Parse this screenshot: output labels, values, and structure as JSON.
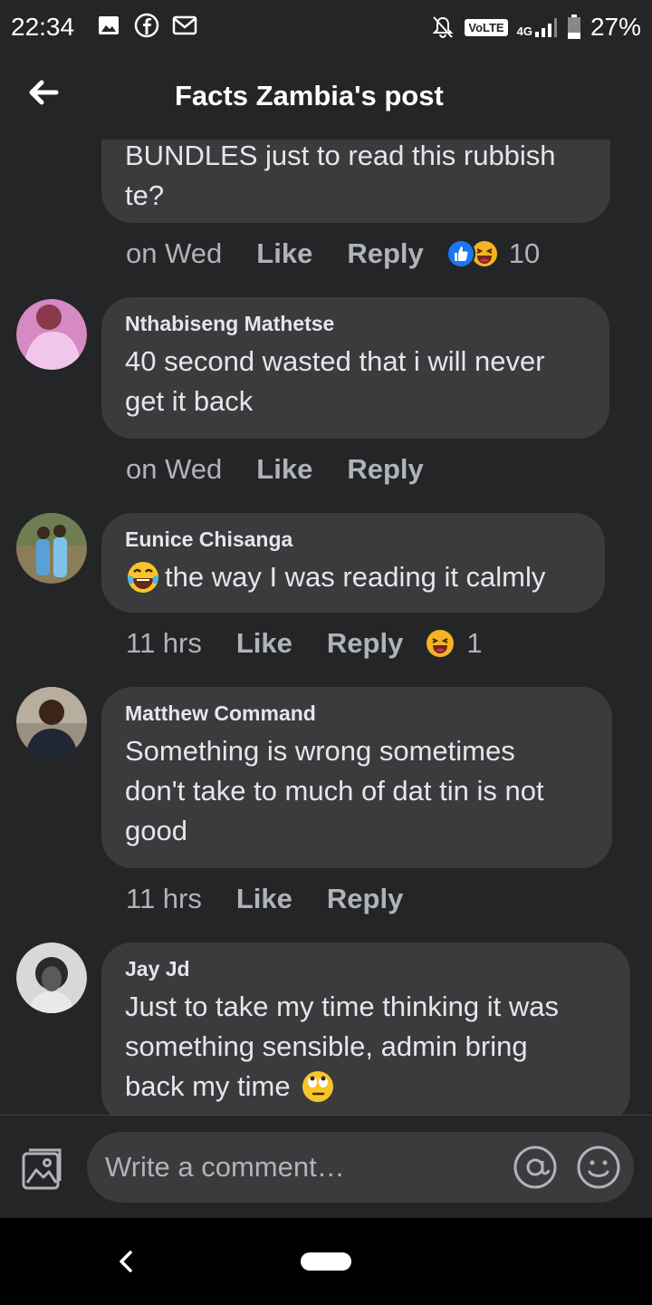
{
  "status_bar": {
    "time": "22:34",
    "icons_left": [
      "gallery-icon",
      "facebook-icon",
      "gmail-icon"
    ],
    "volte": "VoLTE",
    "network": "4G",
    "battery": "27%"
  },
  "header": {
    "title": "Facts Zambia's post"
  },
  "comments": [
    {
      "author": "",
      "text_lines": [
        "BUNDLES just to read this rubbish",
        "te?"
      ],
      "time": "on Wed",
      "like_label": "Like",
      "reply_label": "Reply",
      "reactions": [
        "like",
        "haha"
      ],
      "reaction_count": "10"
    },
    {
      "author": "Nthabiseng Mathetse",
      "text_lines": [
        "40 second wasted that i will never",
        "get it back"
      ],
      "time": "on Wed",
      "like_label": "Like",
      "reply_label": "Reply",
      "reactions": [],
      "reaction_count": ""
    },
    {
      "author": "Eunice Chisanga",
      "text_lines": [
        "the way I was reading it calmly"
      ],
      "leading_emoji": "tears-of-joy",
      "time": "11 hrs",
      "like_label": "Like",
      "reply_label": "Reply",
      "reactions": [
        "haha"
      ],
      "reaction_count": "1"
    },
    {
      "author": "Matthew Command",
      "text_lines": [
        "Something is wrong sometimes",
        "don't take to much of dat tin is not",
        "good"
      ],
      "time": "11 hrs",
      "like_label": "Like",
      "reply_label": "Reply",
      "reactions": [],
      "reaction_count": ""
    },
    {
      "author": "Jay Jd",
      "text_lines": [
        "Just to take my time thinking it was",
        "something sensible, admin bring",
        "back my time"
      ],
      "trailing_emoji": "eye-roll",
      "time": "",
      "like_label": "",
      "reply_label": "",
      "reactions": [],
      "reaction_count": ""
    }
  ],
  "composer": {
    "placeholder": "Write a comment…"
  },
  "colors": {
    "background": "#242526",
    "bubble": "#3a3b3c",
    "primary_text": "#e4e6eb",
    "secondary_text": "#b0b3b8",
    "like_blue": "#1877f2",
    "haha_yellow": "#f7b125"
  }
}
